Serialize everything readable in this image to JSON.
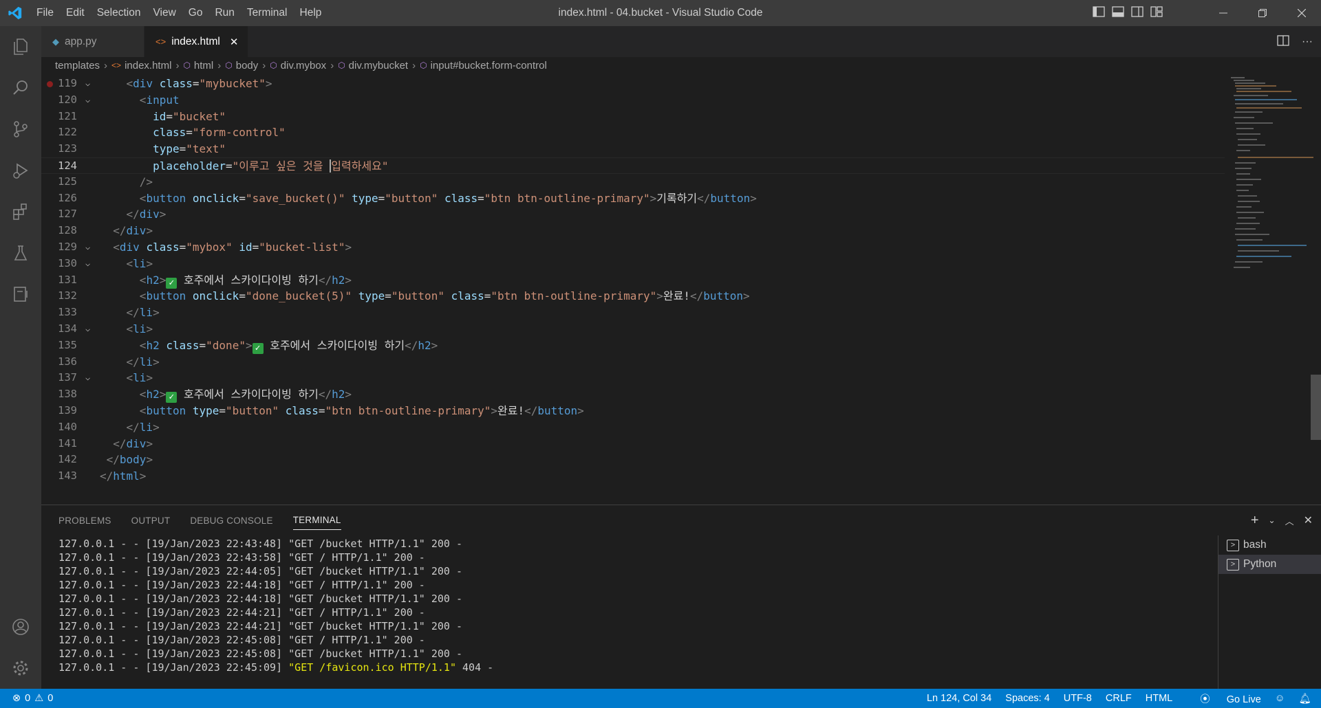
{
  "titlebar": {
    "title": "index.html - 04.bucket - Visual Studio Code",
    "menu": [
      "File",
      "Edit",
      "Selection",
      "View",
      "Go",
      "Run",
      "Terminal",
      "Help"
    ]
  },
  "tabs": [
    {
      "label": "app.py",
      "icon": "python-file-icon",
      "active": false
    },
    {
      "label": "index.html",
      "icon": "html-file-icon",
      "active": true
    }
  ],
  "breadcrumb": [
    "templates",
    "index.html",
    "html",
    "body",
    "div.mybox",
    "div.mybucket",
    "input#bucket.form-control"
  ],
  "editor": {
    "cursor_line": 124,
    "lines": [
      {
        "n": "119",
        "fold": true,
        "bp": true
      },
      {
        "n": "120",
        "fold": true
      },
      {
        "n": "121"
      },
      {
        "n": "122"
      },
      {
        "n": "123"
      },
      {
        "n": "124",
        "current": true
      },
      {
        "n": "125"
      },
      {
        "n": "126"
      },
      {
        "n": "127"
      },
      {
        "n": "128"
      },
      {
        "n": "129",
        "fold": true
      },
      {
        "n": "130",
        "fold": true
      },
      {
        "n": "131"
      },
      {
        "n": "132"
      },
      {
        "n": "133"
      },
      {
        "n": "134",
        "fold": true
      },
      {
        "n": "135"
      },
      {
        "n": "136"
      },
      {
        "n": "137",
        "fold": true
      },
      {
        "n": "138"
      },
      {
        "n": "139"
      },
      {
        "n": "140"
      },
      {
        "n": "141"
      },
      {
        "n": "142"
      },
      {
        "n": "143"
      }
    ],
    "code": {
      "l119": "    <div class=\"mybucket\">",
      "l120": "      <input",
      "l121": "        id=\"bucket\"",
      "l122": "        class=\"form-control\"",
      "l123": "        type=\"text\"",
      "l124": "        placeholder=\"이루고 싶은 것을 입력하세요\"",
      "l125": "      />",
      "l126": "      <button onclick=\"save_bucket()\" type=\"button\" class=\"btn btn-outline-primary\">기록하기</button>",
      "l127": "    </div>",
      "l128": "  </div>",
      "l129": "  <div class=\"mybox\" id=\"bucket-list\">",
      "l130": "    <li>",
      "l131": "      <h2>✅ 호주에서 스카이다이빙 하기</h2>",
      "l132": "      <button onclick=\"done_bucket(5)\" type=\"button\" class=\"btn btn-outline-primary\">완료!</button>",
      "l133": "    </li>",
      "l134": "    <li>",
      "l135": "      <h2 class=\"done\">✅ 호주에서 스카이다이빙 하기</h2>",
      "l136": "    </li>",
      "l137": "    <li>",
      "l138": "      <h2>✅ 호주에서 스카이다이빙 하기</h2>",
      "l139": "      <button type=\"button\" class=\"btn btn-outline-primary\">완료!</button>",
      "l140": "    </li>",
      "l141": "  </div>",
      "l142": "</body>",
      "l143": "</html>"
    }
  },
  "panel": {
    "tabs": [
      "PROBLEMS",
      "OUTPUT",
      "DEBUG CONSOLE",
      "TERMINAL"
    ],
    "active_tab": "TERMINAL",
    "terminal_lines": [
      "127.0.0.1 - - [19/Jan/2023 22:43:48] \"GET /bucket HTTP/1.1\" 200 -",
      "127.0.0.1 - - [19/Jan/2023 22:43:58] \"GET / HTTP/1.1\" 200 -",
      "127.0.0.1 - - [19/Jan/2023 22:44:05] \"GET /bucket HTTP/1.1\" 200 -",
      "127.0.0.1 - - [19/Jan/2023 22:44:18] \"GET / HTTP/1.1\" 200 -",
      "127.0.0.1 - - [19/Jan/2023 22:44:18] \"GET /bucket HTTP/1.1\" 200 -",
      "127.0.0.1 - - [19/Jan/2023 22:44:21] \"GET / HTTP/1.1\" 200 -",
      "127.0.0.1 - - [19/Jan/2023 22:44:21] \"GET /bucket HTTP/1.1\" 200 -",
      "127.0.0.1 - - [19/Jan/2023 22:45:08] \"GET / HTTP/1.1\" 200 -",
      "127.0.0.1 - - [19/Jan/2023 22:45:08] \"GET /bucket HTTP/1.1\" 200 -"
    ],
    "terminal_last": {
      "prefix": "127.0.0.1 - - [19/Jan/2023 22:45:09] ",
      "highlight": "\"GET /favicon.ico HTTP/1.1\"",
      "suffix": " 404 -"
    },
    "terminal_instances": [
      "bash",
      "Python"
    ],
    "selected_instance": "Python"
  },
  "statusbar": {
    "errors": "0",
    "warnings": "0",
    "position": "Ln 124, Col 34",
    "spaces": "Spaces: 4",
    "encoding": "UTF-8",
    "eol": "CRLF",
    "language": "HTML",
    "golive": "Go Live"
  },
  "colors": {
    "accent": "#007acc",
    "tag": "#569cd6",
    "attribute": "#9cdcfe",
    "string": "#ce9178"
  }
}
